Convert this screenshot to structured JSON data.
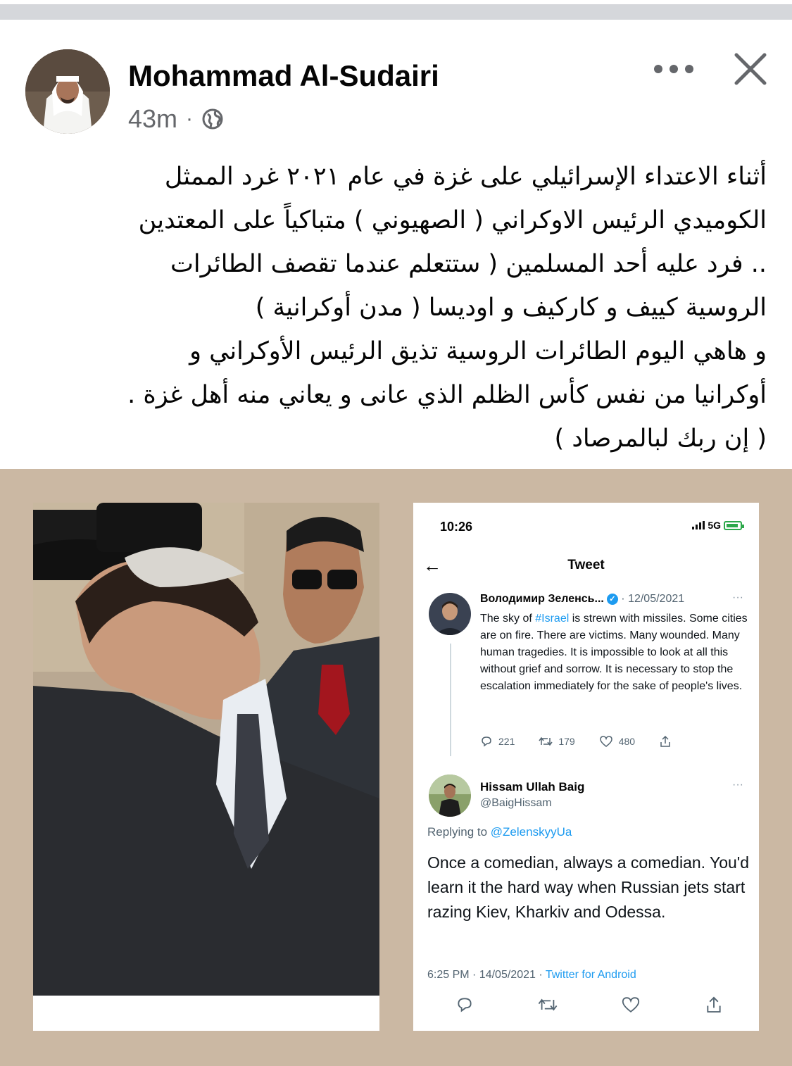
{
  "post": {
    "author": "Mohammad Al-Sudairi",
    "time": "43m",
    "separator": "·",
    "text": "أثناء الاعتداء الإسرائيلي على غزة في عام ٢٠٢١ غرد الممثل\nالكوميدي الرئيس الاوكراني ( الصهيوني ) متباكياً على المعتدين\n.. فرد عليه أحد المسلمين ( ستتعلم عندما تقصف الطائرات\nالروسية كييف و كاركيف و اوديسا ( مدن أوكرانية )\nو هاهي اليوم الطائرات الروسية تذيق الرئيس الأوكراني و\nأوكرانيا من نفس كأس الظلم الذي عانى و يعاني منه أهل غزة .\n( إن ربك لبالمرصاد )"
  },
  "phone": {
    "time": "10:26",
    "network": "5G",
    "header": "Tweet",
    "back": "←",
    "tweet1": {
      "name": "Володимир Зеленсь...",
      "verified": "✓",
      "date": " · 12/05/2021",
      "more": "···",
      "text_before": "The sky of ",
      "hashtag": "#Israel",
      "text_after": " is strewn with missiles. Some cities are on fire. There are victims. Many wounded. Many human tragedies. It is impossible to look at all this without grief and sorrow. It is necessary to stop the escalation immediately for the sake of people's lives.",
      "replies": "221",
      "retweets": "179",
      "likes": "480"
    },
    "tweet2": {
      "name": "Hissam Ullah Baig",
      "handle": "@BaigHissam",
      "more": "···",
      "replying_label": "Replying to ",
      "replying_to": "@ZelenskyyUa",
      "text": "Once a comedian, always a comedian. You'd learn it the hard way when Russian jets start razing Kiev, Kharkiv and Odessa.",
      "timestamp": "6:25 PM · 14/05/2021 · ",
      "source": "Twitter for Android"
    }
  },
  "colors": {
    "media_background": "#cbb8a3",
    "twitter_blue": "#1d9bf0",
    "muted_text": "#65676b"
  }
}
